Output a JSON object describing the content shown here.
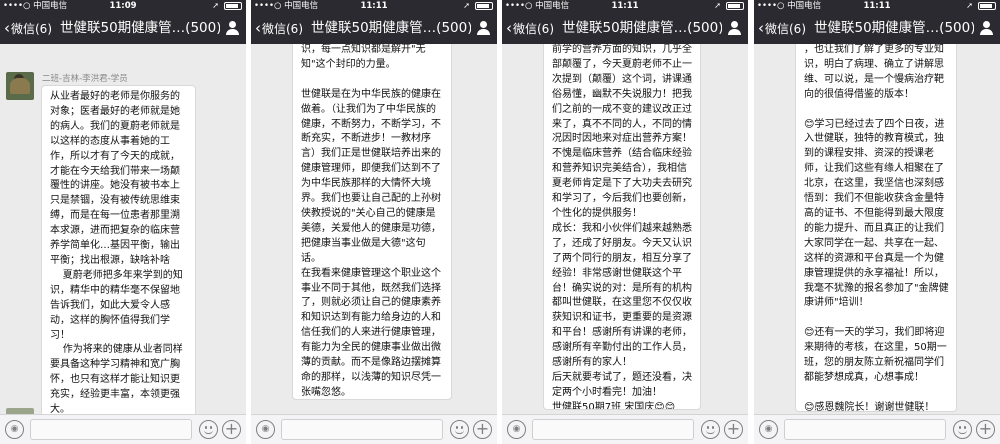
{
  "common": {
    "carrier": "••••○ 中国电信",
    "back_label": "微信(6)",
    "title": "世健联50期健康管…(500)",
    "voice_icon": "voice-icon",
    "emoji_icon": "emoji-icon",
    "plus_icon": "plus-icon",
    "members_icon": "group-members-icon"
  },
  "screens": [
    {
      "time": "11:09",
      "sender": "二班-吉林-李洪君-学员",
      "text": "从业者最好的老师是你服务的对象；医者最好的老师就是她的病人。我们的夏蔚老师就是以这样的态度从事着她的工作，所以才有了今天的成就，才能在今天给我们带来一场颠覆性的讲座。她没有被书本上只是禁锢，没有被传统思维束缚，而是在每一位患者那里溯本求源，进而把复杂的临床营养学简单化…基因平衡，输出平衡；找出根源，缺啥补啥\n    夏蔚老师把多年来学到的知识，精华中的精华毫不保留地告诉我们，如此大爱令人感动，这样的胸怀值得我们学习！\n    作为将来的健康从业者同样要具备这种学习精神和宽广胸怀，也只有这样才能让知识更充实，经验更丰富，本领更强大。"
    },
    {
      "time": "11:11",
      "text": "识，每一点知识都是解开\"无知\"这个封印的力量。\n\n世健联是在为中华民族的健康在做着。（让我们为了中华民族的健康，不断努力，不断学习，不断充实，不断进步！一教材序言）我们正是世健联培养出来的健康管理师，即便我们达到不了为中华民族那样的大情怀大境界。我们也要让自己配的上孙树侠教授说的\"关心自己的健康是美德，关爱他人的健康是功德，把健康当事业做是大德\"这句话。\n在我看来健康管理这个职业这个事业不同于其他，既然我们选择了，则就必须让自己的健康素养和知识达到有能力给身边的人和信任我们的人来进行健康管理，有能力为全民的健康事业做出微薄的贡献。而不是像路边摆摊算命的那样，以浅薄的知识尽凭一张嘴忽悠。\n\n所以做健康管理，不能停止学习，必须不断学习！！"
    },
    {
      "time": "11:11",
      "text": "前学的营养方面的知识，几乎全部颠覆了，今天夏蔚老师不止一次提到（颠覆）这个词，讲课通俗易懂，幽默不失说服力！把我们之前的一成不变的建议改正过来了，真不不同的人，不同的情况因时因地来对症出营养方案！不愧是临床营养（结合临床经验和营养知识完美结合），我相信夏老师肯定是下了大功夫去研究和学习了，今后我们也要创新，个性化的提供服务！\n成长：我和小伙伴们越来越熟悉了，还成了好朋友。今天又认识了两个同行的朋友，相互分享了经验！非常感谢世健联这个平台！确实说的对：是所有的机构都叫世健联，在这里您不仅仅收获知识和证书，更重要的是资源和平台！感谢所有讲课的老师，感谢所有辛勤付出的工作人员，感谢所有的家人！\n后天就要考试了，题还没看，决定两个小时看完！加油！\n世健联50期7班 宋国庆😊😊"
    },
    {
      "time": "11:11",
      "text": "，也让我们了解了更多的专业知识，明白了病理、确立了讲解思维、可以说，是一个慢病治疗靶向的很值得借鉴的版本！\n\n😊学习已经过去了四个日夜，进入世健联，独特的教育模式，独到的课程安排、资深的授课老师，让我们这些有缘人相聚在了北京，在这里，我坚信也深刻感悟到：我们不但能收获含金量特高的证书、不但能得到最大限度的能力提升、而且真正的让我们大家同学在一起、共享在一起、这样的资源和平台真是一个为健康管理提供的永享福祉！所以，我毫不犹豫的报名参加了\"金牌健康讲师\"培训！\n\n😊还有一天的学习，我们即将迎来期待的考核，在这里，50期一班，您的朋友陈立新祝福同学们都能梦想成真，心想事成！\n\n😊感恩魏院长！谢谢世健联！"
    }
  ]
}
